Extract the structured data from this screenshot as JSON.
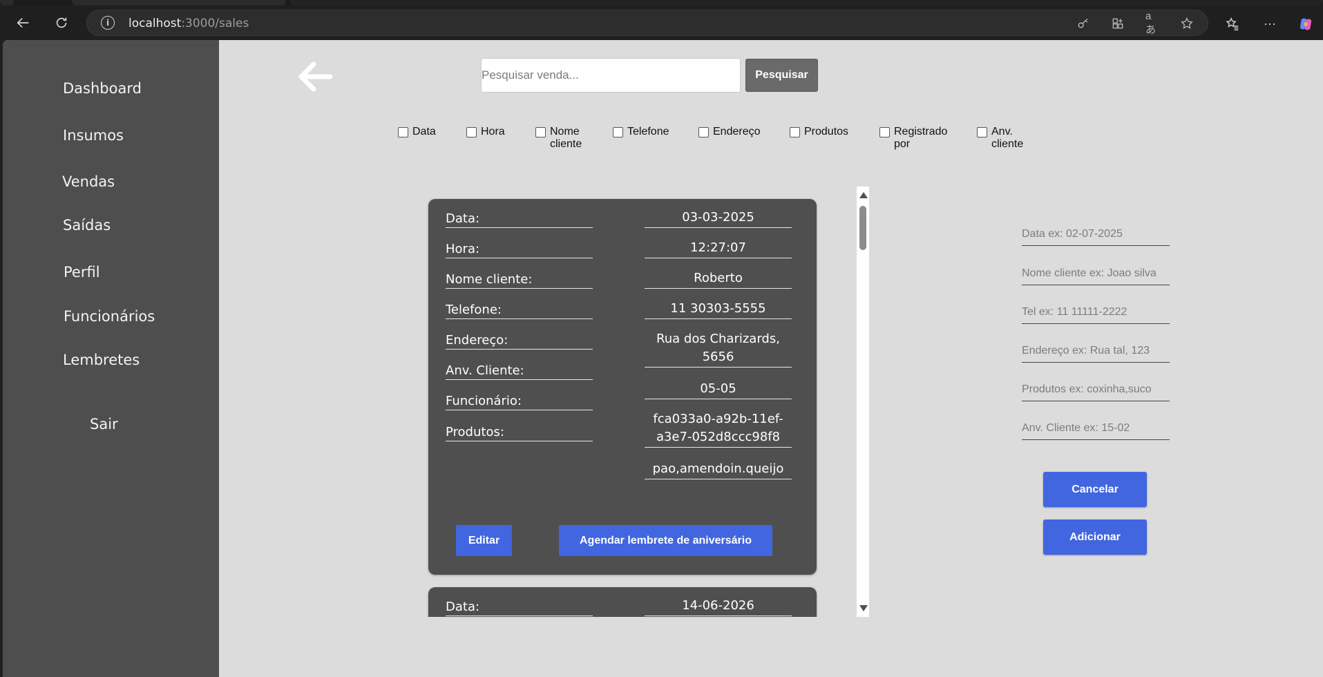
{
  "browser": {
    "url_host": "localhost",
    "url_path": ":3000/sales"
  },
  "sidebar": {
    "items": [
      {
        "label": "Dashboard"
      },
      {
        "label": "Insumos"
      },
      {
        "label": "Vendas"
      },
      {
        "label": "Saídas"
      },
      {
        "label": "Perfil"
      },
      {
        "label": "Funcionários"
      },
      {
        "label": "Lembretes"
      },
      {
        "label": "Sair"
      }
    ]
  },
  "search": {
    "placeholder": "Pesquisar venda...",
    "button_label": "Pesquisar"
  },
  "filters": [
    {
      "label": "Data"
    },
    {
      "label": "Hora"
    },
    {
      "label": "Nome cliente"
    },
    {
      "label": "Telefone"
    },
    {
      "label": "Endereço"
    },
    {
      "label": "Produtos"
    },
    {
      "label": "Registrado por"
    },
    {
      "label": "Anv. cliente"
    }
  ],
  "card_labels": {
    "data": "Data:",
    "hora": "Hora:",
    "nome": "Nome cliente:",
    "telefone": "Telefone:",
    "endereco": "Endereço:",
    "aniversario": "Anv. Cliente:",
    "funcionario": "Funcionário:",
    "produtos": "Produtos:"
  },
  "sales": [
    {
      "data": "03-03-2025",
      "hora": "12:27:07",
      "nome": "Roberto",
      "telefone": "11 30303-5555",
      "endereco": "Rua dos Charizards, 5656",
      "aniversario": "05-05",
      "funcionario": "fca033a0-a92b-11ef-a3e7-052d8ccc98f8",
      "produtos": "pao,amendoin.queijo",
      "edit_label": "Editar",
      "reminder_label": "Agendar lembrete de aniversário"
    },
    {
      "data": "14-06-2026"
    }
  ],
  "form": {
    "data_placeholder": "Data ex: 02-07-2025",
    "nome_placeholder": "Nome cliente ex: Joao silva",
    "tel_placeholder": "Tel ex: 11 11111-2222",
    "endereco_placeholder": "Endereço ex: Rua tal, 123",
    "produtos_placeholder": "Produtos ex: coxinha,suco",
    "aniversario_placeholder": "Anv. Cliente ex: 15-02",
    "cancel_label": "Cancelar",
    "add_label": "Adicionar"
  },
  "colors": {
    "sidebar": "#4e4e4e",
    "card": "#4f4f4f",
    "accent": "#4166df",
    "page_bg": "#dcdcdc"
  }
}
